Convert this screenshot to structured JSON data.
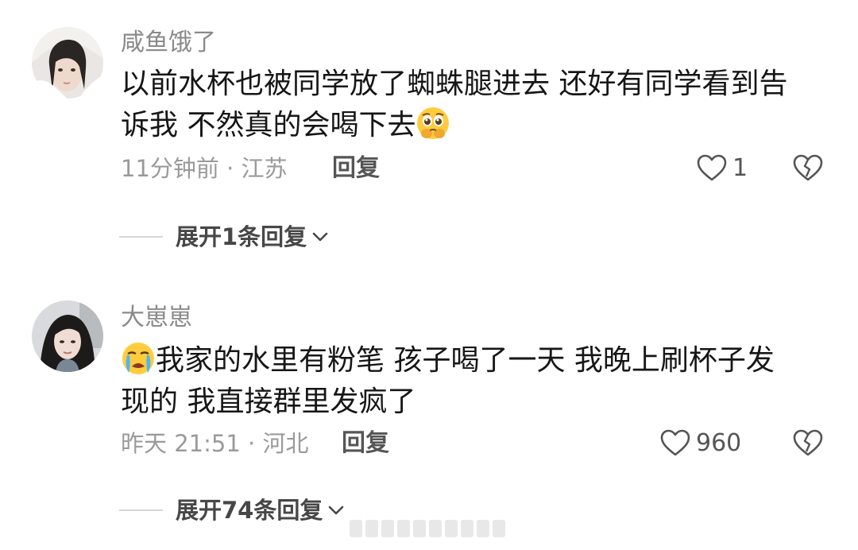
{
  "comments": [
    {
      "username": "咸鱼饿了",
      "text_line1": "以前水杯也被同学放了蜘蛛腿进去 还好有同学看到告",
      "text_line2": "诉我 不然真的会喝下去",
      "emoji": "pleading-face-emoji",
      "meta": "11分钟前 · 江苏",
      "reply_label": "回复",
      "likes": "1",
      "expand_label": "展开1条回复"
    },
    {
      "username": "大崽崽",
      "emoji": "crying-face-emoji",
      "text_line1": "我家的水里有粉笔 孩子喝了一天 我晚上刷杯子发",
      "text_line2": "现的 我直接群里发疯了",
      "meta": "昨天 21:51 · 河北",
      "reply_label": "回复",
      "likes": "960",
      "expand_label": "展开74条回复"
    }
  ],
  "icons": {
    "like": "heart-outline-icon",
    "dislike": "broken-heart-icon",
    "expand": "chevron-down-icon"
  },
  "colors": {
    "text": "#161616",
    "username": "#8a8a8a",
    "meta": "#9a9a9a",
    "action": "#555555"
  }
}
